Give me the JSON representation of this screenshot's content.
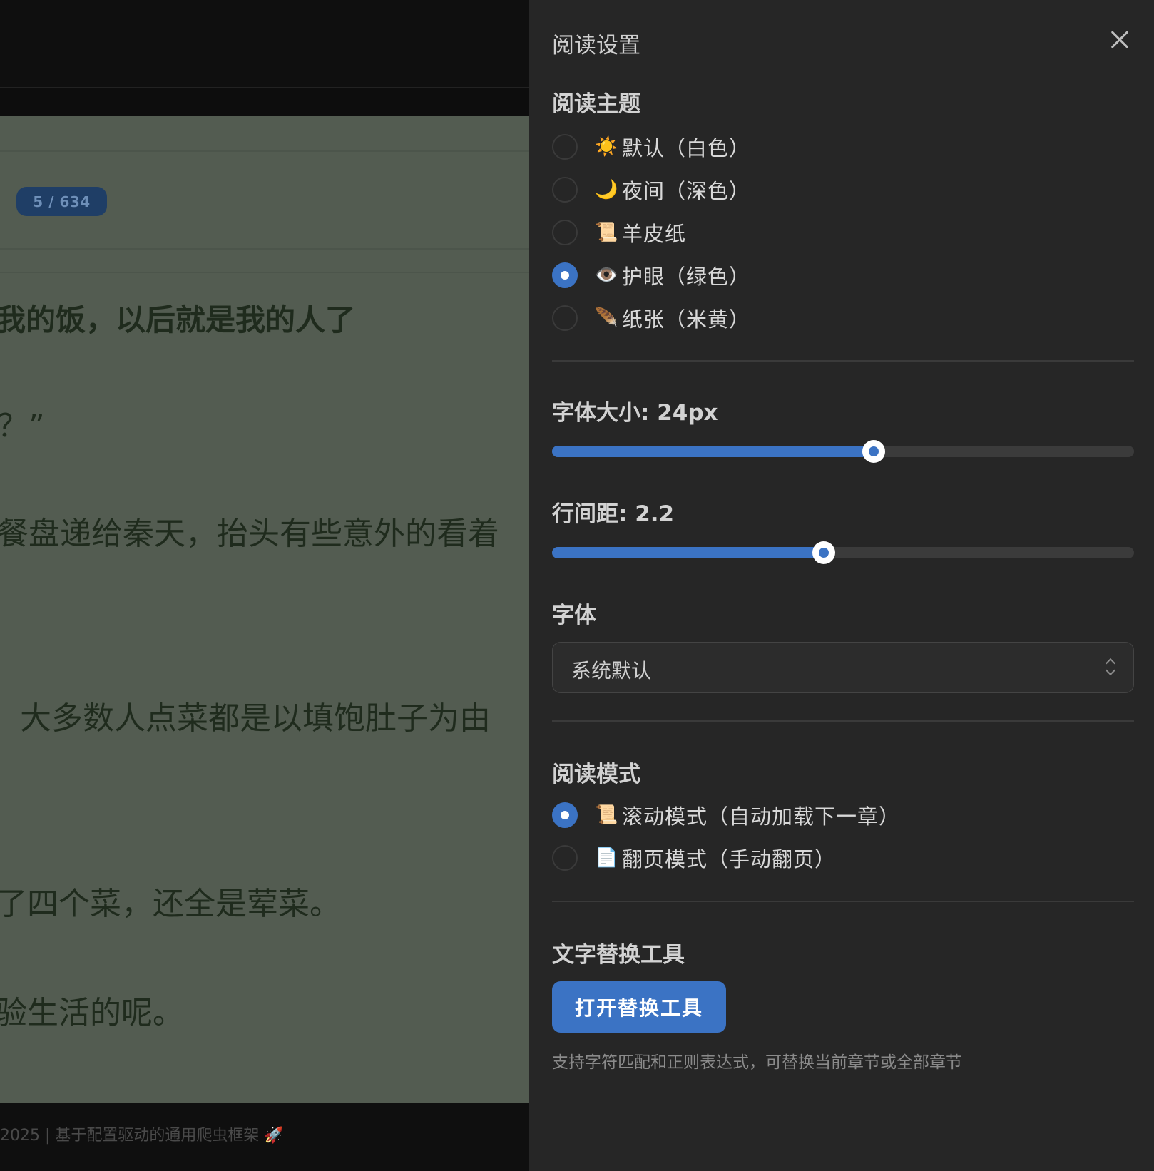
{
  "reader": {
    "page_badge": "5 / 634",
    "paragraphs": [
      "我的饭，以后就是我的人了",
      "？”",
      "餐盘递给秦天，抬头有些意外的看着",
      "大多数人点菜都是以填饱肚子为由",
      "了四个菜，还全是荤菜。",
      "验生活的呢。"
    ],
    "footer_text": "2025 | 基于配置驱动的通用爬虫框架 🚀"
  },
  "panel": {
    "title": "阅读设置",
    "theme": {
      "title": "阅读主题",
      "options": [
        {
          "icon": "☀️",
          "label": "默认（白色）",
          "selected": false
        },
        {
          "icon": "🌙",
          "label": "夜间（深色）",
          "selected": false
        },
        {
          "icon": "📜",
          "label": "羊皮纸",
          "selected": false
        },
        {
          "icon": "👁️",
          "label": "护眼（绿色）",
          "selected": true
        },
        {
          "icon": "🪶",
          "label": "纸张（米黄）",
          "selected": false
        }
      ]
    },
    "font_size": {
      "label": "字体大小: 24px",
      "value_fraction": 0.553
    },
    "line_height": {
      "label": "行间距: 2.2",
      "value_fraction": 0.467
    },
    "font": {
      "title": "字体",
      "value": "系统默认"
    },
    "mode": {
      "title": "阅读模式",
      "options": [
        {
          "icon": "📜",
          "label": "滚动模式（自动加载下一章）",
          "selected": true
        },
        {
          "icon": "📄",
          "label": "翻页模式（手动翻页）",
          "selected": false
        }
      ]
    },
    "replace": {
      "title": "文字替换工具",
      "button": "打开替换工具",
      "hint": "支持字符匹配和正则表达式，可替换当前章节或全部章节"
    }
  },
  "colors": {
    "accent": "#3b73c4",
    "panel_bg": "#262626",
    "reader_bg": "#535c51"
  }
}
